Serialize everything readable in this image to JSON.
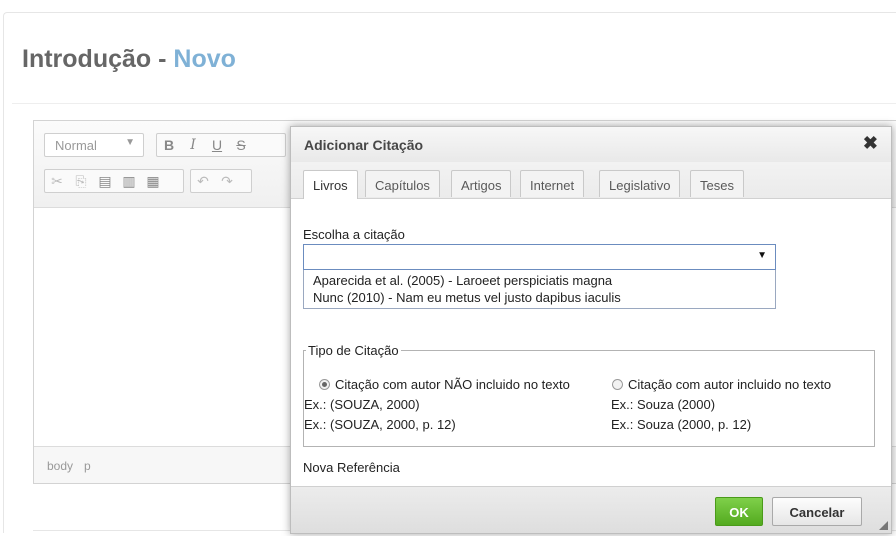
{
  "page": {
    "title_main": "Introdução - ",
    "title_accent": "Novo"
  },
  "editor": {
    "format_combo": "Normal",
    "format_buttons": [
      "B",
      "I",
      "U",
      "S"
    ],
    "clipboard_icons": [
      "cut-icon",
      "copy-icon",
      "paste-icon",
      "paste-text-icon",
      "paste-word-icon",
      "undo-icon",
      "redo-icon"
    ],
    "statusbar_path": [
      "body",
      "p"
    ]
  },
  "dialog": {
    "title": "Adicionar Citação",
    "close_glyph": "✖",
    "tabs": [
      {
        "label": "Livros",
        "active": true
      },
      {
        "label": "Capítulos",
        "active": false
      },
      {
        "label": "Artigos",
        "active": false
      },
      {
        "label": "Internet",
        "active": false
      },
      {
        "label": "Legislativo",
        "active": false
      },
      {
        "label": "Teses",
        "active": false
      }
    ],
    "choose_label": "Escolha a citação",
    "select_value": "",
    "options": [
      "Aparecida et al. (2005) - Laroeet perspiciatis magna",
      "Nunc (2010) - Nam eu metus vel justo dapibus iaculis"
    ],
    "tipo": {
      "legend": "Tipo de Citação",
      "option1": {
        "label": "Citação com autor NÃO incluido no texto",
        "ex1": "Ex.: (SOUZA, 2000)",
        "ex2": "Ex.: (SOUZA, 2000, p. 12)",
        "checked": true
      },
      "option2": {
        "label": "Citação com autor incluido no texto",
        "ex1": "Ex.: Souza (2000)",
        "ex2": "Ex.: Souza (2000, p. 12)",
        "checked": false
      }
    },
    "nova_referencia": "Nova Referência",
    "ok_label": "OK",
    "cancel_label": "Cancelar"
  },
  "colors": {
    "accent_title": "#7fb1d6",
    "ok_button": "#5cb82a"
  }
}
